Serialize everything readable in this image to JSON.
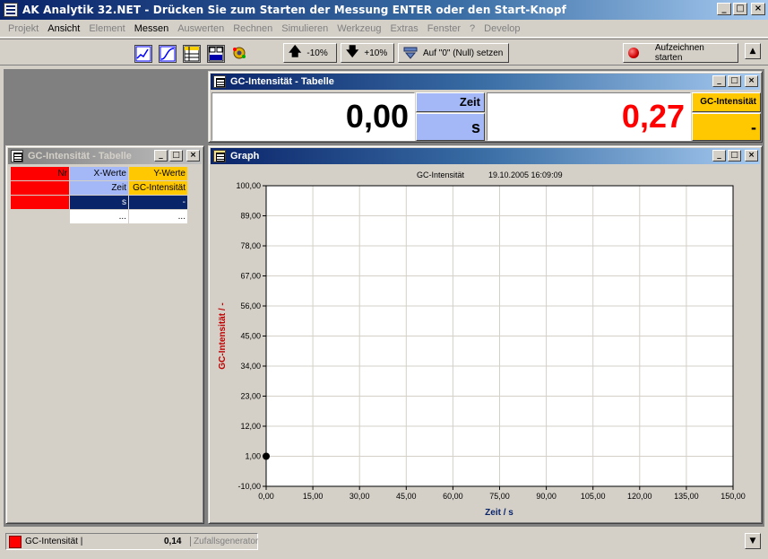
{
  "app": {
    "title": "AK Analytik 32.NET - Drücken Sie zum Starten der Messung ENTER oder den Start-Knopf"
  },
  "menu": [
    {
      "label": "Projekt",
      "enabled": false
    },
    {
      "label": "Ansicht",
      "enabled": true
    },
    {
      "label": "Element",
      "enabled": false
    },
    {
      "label": "Messen",
      "enabled": true
    },
    {
      "label": "Auswerten",
      "enabled": false
    },
    {
      "label": "Rechnen",
      "enabled": false
    },
    {
      "label": "Simulieren",
      "enabled": false
    },
    {
      "label": "Werkzeug",
      "enabled": false
    },
    {
      "label": "Extras",
      "enabled": false
    },
    {
      "label": "Fenster",
      "enabled": false
    },
    {
      "label": "?",
      "enabled": false
    },
    {
      "label": "Develop",
      "enabled": false
    }
  ],
  "toolbar": {
    "minus10": "-10%",
    "plus10": "+10%",
    "zero": "Auf \"0\" (Null) setzen",
    "record": "Aufzeichnen starten"
  },
  "display_window": {
    "title": "GC-Intensität - Tabelle",
    "x_value": "0,00",
    "x_label": "Zeit",
    "x_unit": "s",
    "y_value": "0,27",
    "y_label": "GC-Intensität",
    "y_unit": "-"
  },
  "table_window": {
    "title": "GC-Intensität - Tabelle",
    "header": {
      "nr": "Nr",
      "x": "X-Werte",
      "y": "Y-Werte"
    },
    "names": {
      "x": "Zeit",
      "y": "GC-Intensität"
    },
    "units": {
      "x": "s",
      "y": "-"
    },
    "empty_row": {
      "x": "...",
      "y": "..."
    }
  },
  "graph_window": {
    "title": "Graph",
    "header_title": "GC-Intensität",
    "header_date": "19.10.2005 16:09:09"
  },
  "chart_data": {
    "type": "scatter",
    "title": "GC-Intensität",
    "xlabel": "Zeit / s",
    "ylabel": "GC-Intensität / -",
    "xlim": [
      0,
      150
    ],
    "ylim": [
      -10,
      100
    ],
    "x_ticks": [
      "0,00",
      "15,00",
      "30,00",
      "45,00",
      "60,00",
      "75,00",
      "90,00",
      "105,00",
      "120,00",
      "135,00",
      "150,00"
    ],
    "y_ticks": [
      "100,00",
      "89,00",
      "78,00",
      "67,00",
      "56,00",
      "45,00",
      "34,00",
      "23,00",
      "12,00",
      "1,00",
      "-10,00"
    ],
    "x_tick_values": [
      0,
      15,
      30,
      45,
      60,
      75,
      90,
      105,
      120,
      135,
      150
    ],
    "y_tick_values": [
      100,
      89,
      78,
      67,
      56,
      45,
      34,
      23,
      12,
      1,
      -10
    ],
    "grid": true,
    "series": [
      {
        "x": [
          0
        ],
        "y": [
          1
        ]
      }
    ]
  },
  "status": {
    "label": "GC-Intensität |",
    "value": "0,14",
    "generator": "Zufallsgenerator"
  },
  "colors": {
    "x_accent": "#a4b8f8",
    "y_accent": "#ffc800",
    "value_red": "#ff0000",
    "title_blue": "#0a246a"
  }
}
